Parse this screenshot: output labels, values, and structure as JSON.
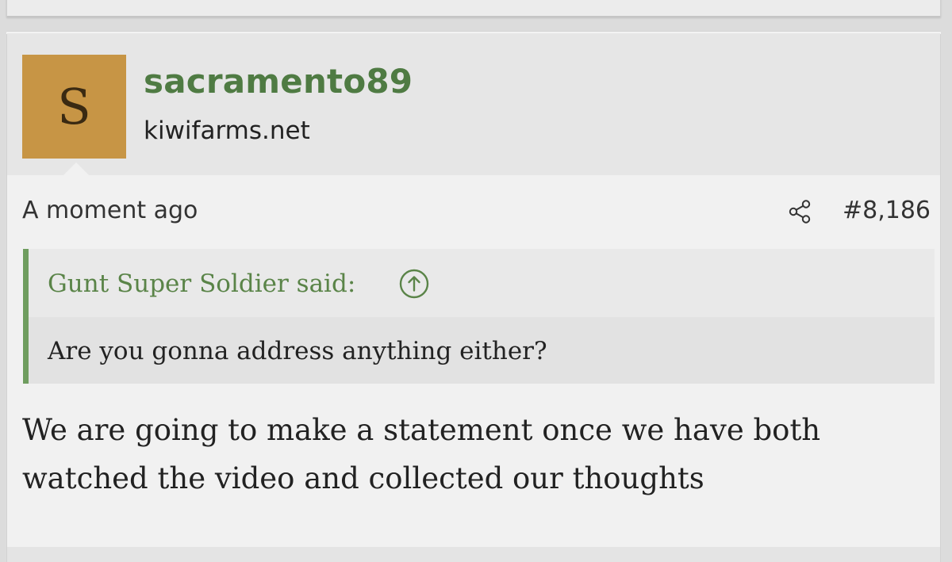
{
  "post": {
    "avatar_letter": "S",
    "username": "sacramento89",
    "site": "kiwifarms.net",
    "timestamp": "A moment ago",
    "share_icon": "share-icon",
    "post_number": "#8,186",
    "quote": {
      "author_label": "Gunt Super Soldier said:",
      "jump_icon": "arrow-up-circle-icon",
      "text": "Are you gonna address anything either?"
    },
    "message": "We are going to make a statement once we have both watched the video and collected our thoughts"
  },
  "colors": {
    "username": "#4f7b43",
    "avatar_background": "#c79545",
    "quote_accent": "#6f9d5f",
    "page_background": "#f1f1f1"
  }
}
